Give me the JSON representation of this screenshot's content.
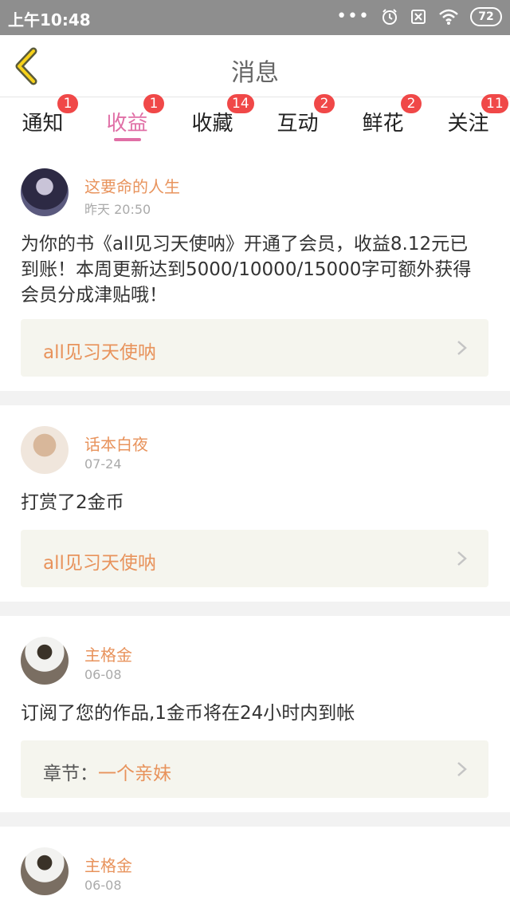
{
  "status_bar": {
    "time": "上午10:48",
    "battery": "72"
  },
  "nav": {
    "title": "消息"
  },
  "tabs": [
    {
      "label": "通知",
      "badge": "1"
    },
    {
      "label": "收益",
      "badge": "1"
    },
    {
      "label": "收藏",
      "badge": "14"
    },
    {
      "label": "互动",
      "badge": "2"
    },
    {
      "label": "鲜花",
      "badge": "2"
    },
    {
      "label": "关注",
      "badge": "11"
    }
  ],
  "active_tab_index": 1,
  "messages": [
    {
      "author": "这要命的人生",
      "time": "昨天 20:50",
      "text": "为你的书《all见习天使呐》开通了会员，收益8.12元已到账！本周更新达到5000/10000/15000字可额外获得会员分成津贴哦！",
      "link": "all见习天使呐"
    },
    {
      "author": "话本白夜",
      "time": "07-24",
      "text": "打赏了2金币",
      "link": "all见习天使呐"
    },
    {
      "author": "主格金",
      "time": "06-08",
      "text": "订阅了您的作品,1金币将在24小时内到帐",
      "link_prefix": "章节：",
      "link": "一个亲妹"
    },
    {
      "author": "主格金",
      "time": "06-08"
    }
  ],
  "colors": {
    "accent": "#e06fa6",
    "author": "#e8935c",
    "badge": "#f04848",
    "link_bg": "#f5f5ee"
  }
}
